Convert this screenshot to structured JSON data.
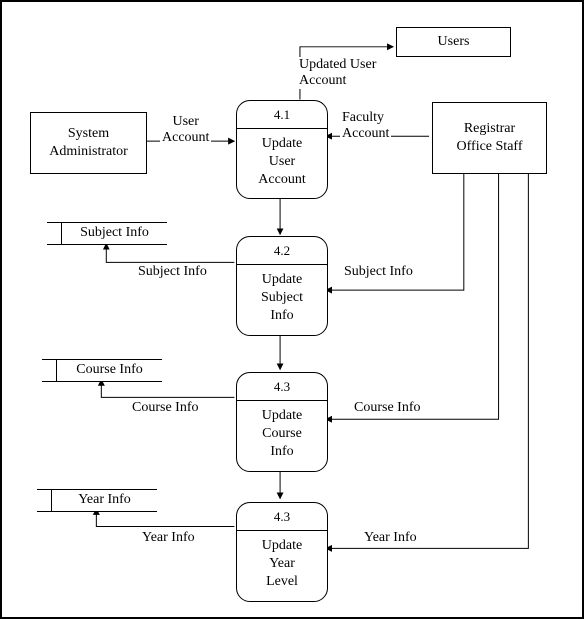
{
  "entities": {
    "sys_admin": "System\nAdministrator",
    "registrar": "Registrar\nOffice Staff",
    "users": "Users"
  },
  "processes": {
    "p1": {
      "id": "4.1",
      "name": "Update\nUser\nAccount"
    },
    "p2": {
      "id": "4.2",
      "name": "Update\nSubject\nInfo"
    },
    "p3": {
      "id": "4.3",
      "name": "Update\nCourse\nInfo"
    },
    "p4": {
      "id": "4.3",
      "name": "Update\nYear\nLevel"
    }
  },
  "stores": {
    "subject": "Subject Info",
    "course": "Course Info",
    "year": "Year Info"
  },
  "flows": {
    "user_account": "User\nAccount",
    "faculty_account": "Faculty\nAccount",
    "updated_user_account": "Updated User\nAccount",
    "subject_info_out": "Subject Info",
    "subject_info_in": "Subject Info",
    "course_info_out": "Course Info",
    "course_info_in": "Course Info",
    "year_info_out": "Year Info",
    "year_info_in": "Year Info"
  },
  "chart_data": {
    "type": "diagram",
    "title": "",
    "subtype": "data-flow-diagram-level-2",
    "external_entities": [
      {
        "id": "sys_admin",
        "label": "System Administrator"
      },
      {
        "id": "registrar",
        "label": "Registrar Office Staff"
      },
      {
        "id": "users",
        "label": "Users"
      }
    ],
    "processes": [
      {
        "id": "4.1",
        "label": "Update User Account"
      },
      {
        "id": "4.2",
        "label": "Update Subject Info"
      },
      {
        "id": "4.3a",
        "number": "4.3",
        "label": "Update Course Info"
      },
      {
        "id": "4.3b",
        "number": "4.3",
        "label": "Update Year Level"
      }
    ],
    "data_stores": [
      {
        "id": "subject",
        "label": "Subject Info"
      },
      {
        "id": "course",
        "label": "Course Info"
      },
      {
        "id": "year",
        "label": "Year Info"
      }
    ],
    "flows": [
      {
        "from": "sys_admin",
        "to": "4.1",
        "label": "User Account"
      },
      {
        "from": "registrar",
        "to": "4.1",
        "label": "Faculty Account"
      },
      {
        "from": "4.1",
        "to": "users",
        "label": "Updated User Account"
      },
      {
        "from": "4.1",
        "to": "4.2",
        "label": ""
      },
      {
        "from": "registrar",
        "to": "4.2",
        "label": "Subject Info"
      },
      {
        "from": "4.2",
        "to": "subject",
        "label": "Subject Info"
      },
      {
        "from": "4.2",
        "to": "4.3a",
        "label": ""
      },
      {
        "from": "registrar",
        "to": "4.3a",
        "label": "Course Info"
      },
      {
        "from": "4.3a",
        "to": "course",
        "label": "Course Info"
      },
      {
        "from": "4.3a",
        "to": "4.3b",
        "label": ""
      },
      {
        "from": "registrar",
        "to": "4.3b",
        "label": "Year Info"
      },
      {
        "from": "4.3b",
        "to": "year",
        "label": "Year Info"
      }
    ]
  }
}
